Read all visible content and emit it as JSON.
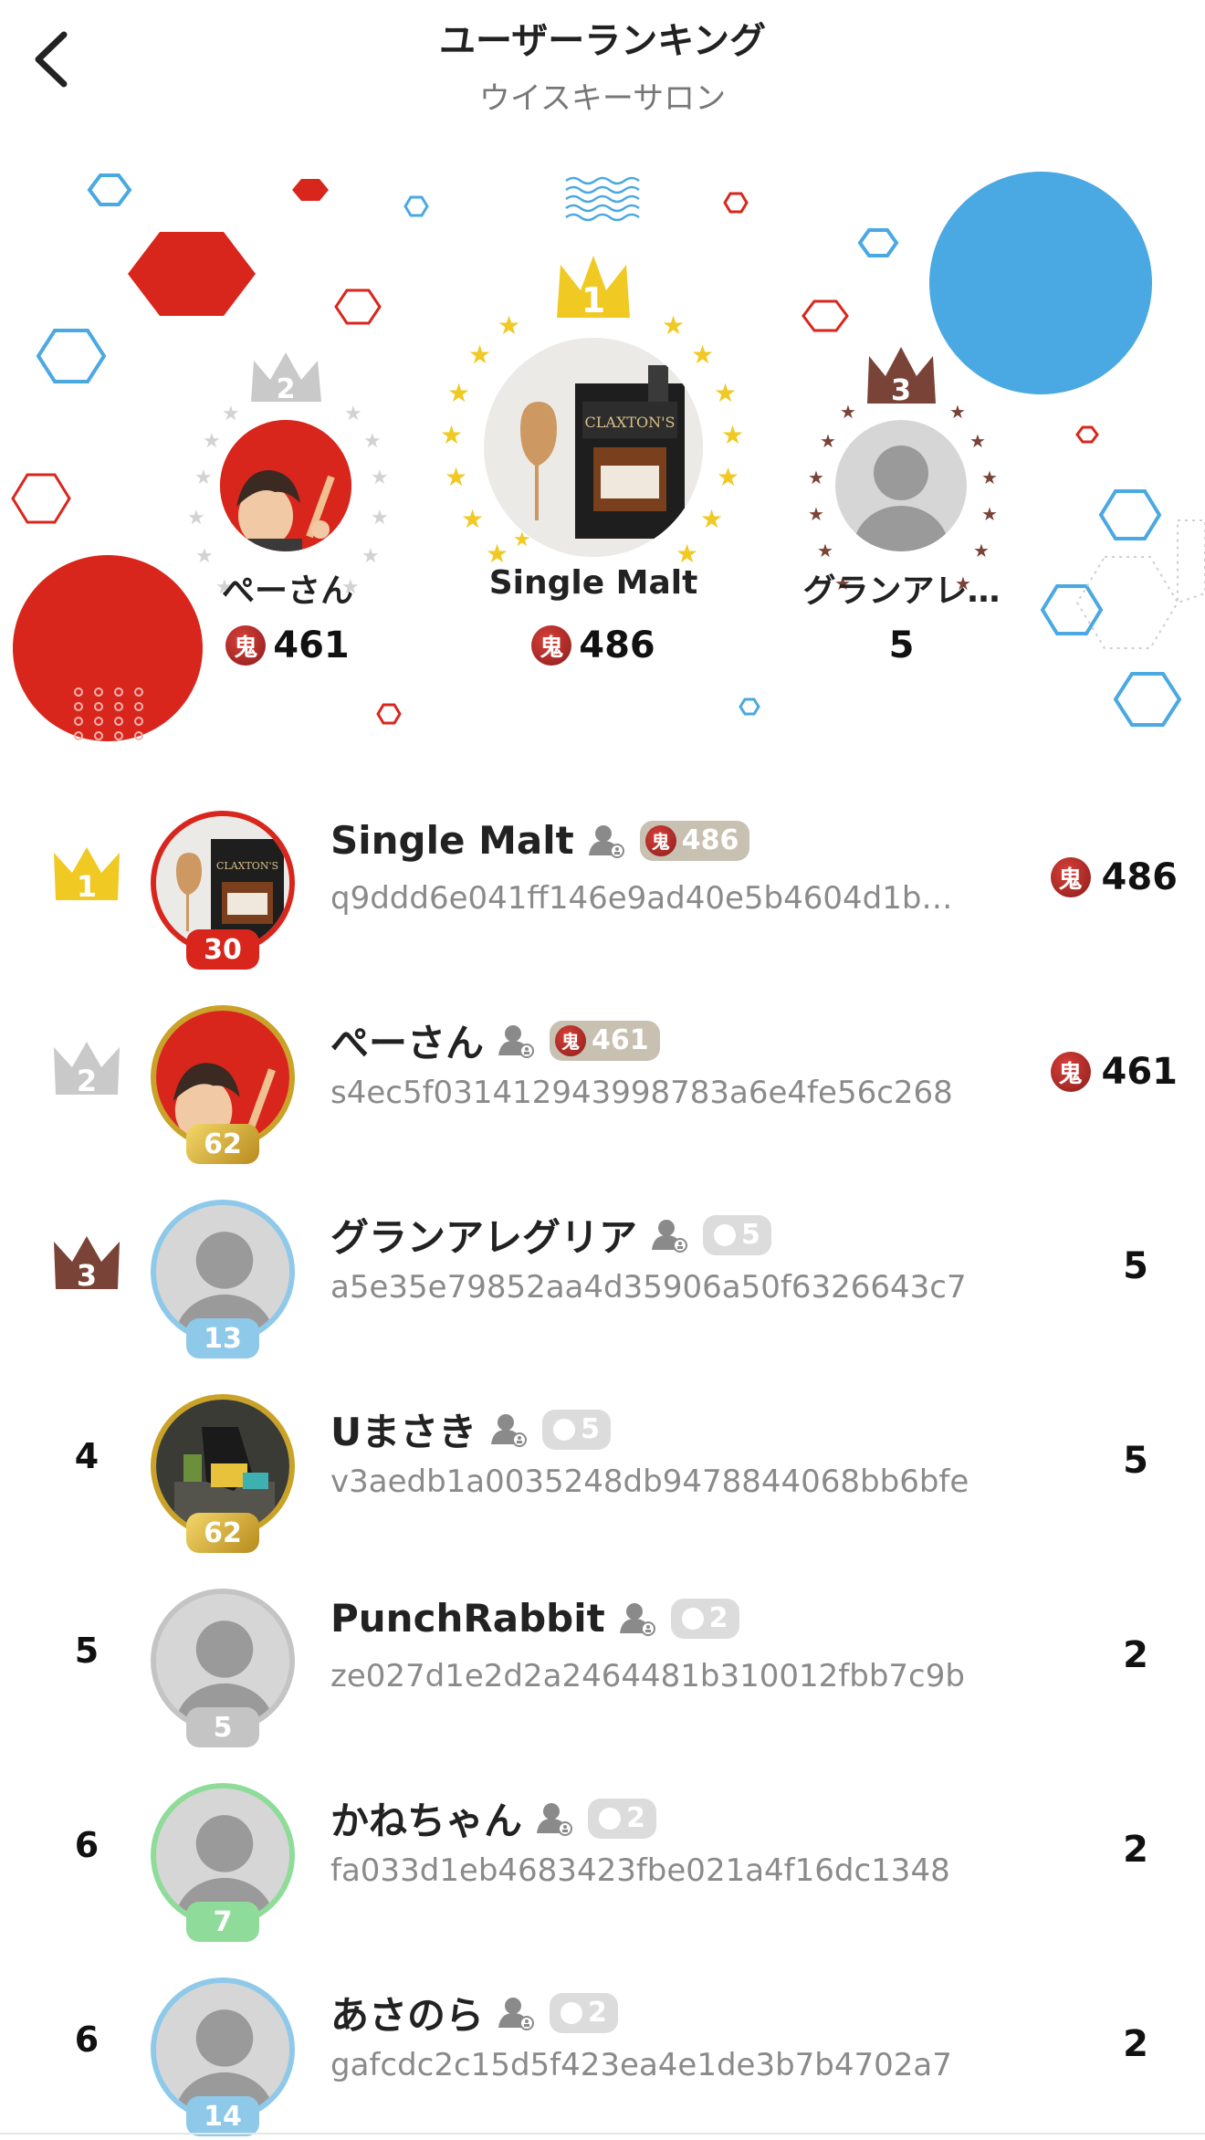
{
  "header": {
    "title": "ユーザーランキング",
    "subtitle": "ウイスキーサロン"
  },
  "colors": {
    "gold": "#f0c923",
    "silver": "#c9c9c9",
    "bronze": "#7a4337",
    "red": "#d9261c",
    "blue": "#4aa8e2",
    "level_red": "#d9261c",
    "level_gold": "#c9a227",
    "level_blue": "#8ec9ea",
    "level_grey": "#c4c4c4",
    "level_green": "#8fdc9a"
  },
  "podium": [
    {
      "rank": "2",
      "name": "ぺーさん",
      "score": "461",
      "has_oni": true,
      "avatar": "cartoon"
    },
    {
      "rank": "1",
      "name": "Single Malt",
      "score": "486",
      "has_oni": true,
      "avatar": "bottle"
    },
    {
      "rank": "3",
      "name": "グランアレ…",
      "score": "5",
      "has_oni": false,
      "avatar": "default"
    }
  ],
  "rankings": [
    {
      "rank": "1",
      "rank_display": "crown",
      "crown_color": "gold",
      "name": "Single Malt",
      "id": "q9ddd6e041ff146e9ad40e5b4604d1b…",
      "pill": "486",
      "pill_type": "oni",
      "score": "486",
      "score_oni": true,
      "level": "30",
      "level_color": "red",
      "ring": "red",
      "avatar": "bottle"
    },
    {
      "rank": "2",
      "rank_display": "crown",
      "crown_color": "silver",
      "name": "ぺーさん",
      "id": "s4ec5f031412943998783a6e4fe56c268",
      "pill": "461",
      "pill_type": "oni",
      "score": "461",
      "score_oni": true,
      "level": "62",
      "level_color": "gold",
      "ring": "gold",
      "avatar": "cartoon"
    },
    {
      "rank": "3",
      "rank_display": "crown",
      "crown_color": "bronze",
      "name": "グランアレグリア",
      "id": "a5e35e79852aa4d35906a50f6326643c7",
      "pill": "5",
      "pill_type": "grey",
      "score": "5",
      "score_oni": false,
      "level": "13",
      "level_color": "blue",
      "ring": "blue",
      "avatar": "default"
    },
    {
      "rank": "4",
      "rank_display": "number",
      "name": "Uまさき",
      "id": "v3aedb1a0035248db9478844068bb6bfe",
      "pill": "5",
      "pill_type": "grey",
      "score": "5",
      "score_oni": false,
      "level": "62",
      "level_color": "gold",
      "ring": "gold",
      "avatar": "photo"
    },
    {
      "rank": "5",
      "rank_display": "number",
      "name": "PunchRabbit",
      "id": "ze027d1e2d2a2464481b310012fbb7c9b",
      "pill": "2",
      "pill_type": "grey",
      "score": "2",
      "score_oni": false,
      "level": "5",
      "level_color": "grey",
      "ring": "grey",
      "avatar": "default"
    },
    {
      "rank": "6",
      "rank_display": "number",
      "name": "かねちゃん",
      "id": "fa033d1eb4683423fbe021a4f16dc1348",
      "pill": "2",
      "pill_type": "grey",
      "score": "2",
      "score_oni": false,
      "level": "7",
      "level_color": "green",
      "ring": "green",
      "avatar": "default"
    },
    {
      "rank": "6",
      "rank_display": "number",
      "name": "あさのら",
      "id": "gafcdc2c15d5f423ea4e1de3b7b4702a7",
      "pill": "2",
      "pill_type": "grey",
      "score": "2",
      "score_oni": false,
      "level": "14",
      "level_color": "blue",
      "ring": "blue",
      "avatar": "default"
    }
  ]
}
